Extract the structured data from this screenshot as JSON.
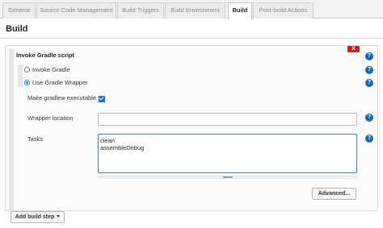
{
  "tabs": [
    {
      "label": "General"
    },
    {
      "label": "Source Code Management"
    },
    {
      "label": "Build Triggers"
    },
    {
      "label": "Build Environment"
    },
    {
      "label": "Build"
    },
    {
      "label": "Post-build Actions"
    }
  ],
  "section": {
    "title": "Build"
  },
  "step": {
    "title": "Invoke Gradle script",
    "delete_label": "X",
    "help_label": "?",
    "options": [
      {
        "label": "Invoke Gradle",
        "selected": false
      },
      {
        "label": "Use Gradle Wrapper",
        "selected": true
      }
    ],
    "make_executable_label": "Make gradlew executable",
    "make_executable_checked": true,
    "wrapper_location_label": "Wrapper location",
    "wrapper_location_value": "",
    "tasks_label": "Tasks",
    "tasks_value": "clean\nassembleDebug",
    "advanced_label": "Advanced..."
  },
  "add_step": {
    "label": "Add build step"
  },
  "colors": {
    "accent": "#1e88e5",
    "help": "#1565c0",
    "delete": "#cc2222"
  }
}
